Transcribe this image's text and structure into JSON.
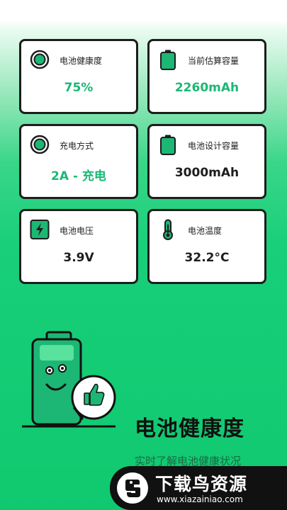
{
  "cards": [
    {
      "label": "电池健康度",
      "value": "75%",
      "icon": "health-ring-icon"
    },
    {
      "label": "当前估算容量",
      "value": "2260mAh",
      "icon": "battery-icon"
    },
    {
      "label": "充电方式",
      "value": "2A - 充电",
      "icon": "charge-ring-icon"
    },
    {
      "label": "电池设计容量",
      "value": "3000mAh",
      "icon": "battery-icon"
    },
    {
      "label": "电池电压",
      "value": "3.9V",
      "icon": "lightning-icon"
    },
    {
      "label": "电池温度",
      "value": "32.2°C",
      "icon": "thermometer-icon"
    }
  ],
  "hero": {
    "title": "电池健康度",
    "subtitle": "实时了解电池健康状况"
  },
  "watermark": {
    "title": "下载鸟资源",
    "url": "www.xiazainiao.com"
  },
  "colors": {
    "accent": "#1cb774",
    "gradient_bottom": "#10c96f",
    "card_border": "#1d1d1d"
  }
}
